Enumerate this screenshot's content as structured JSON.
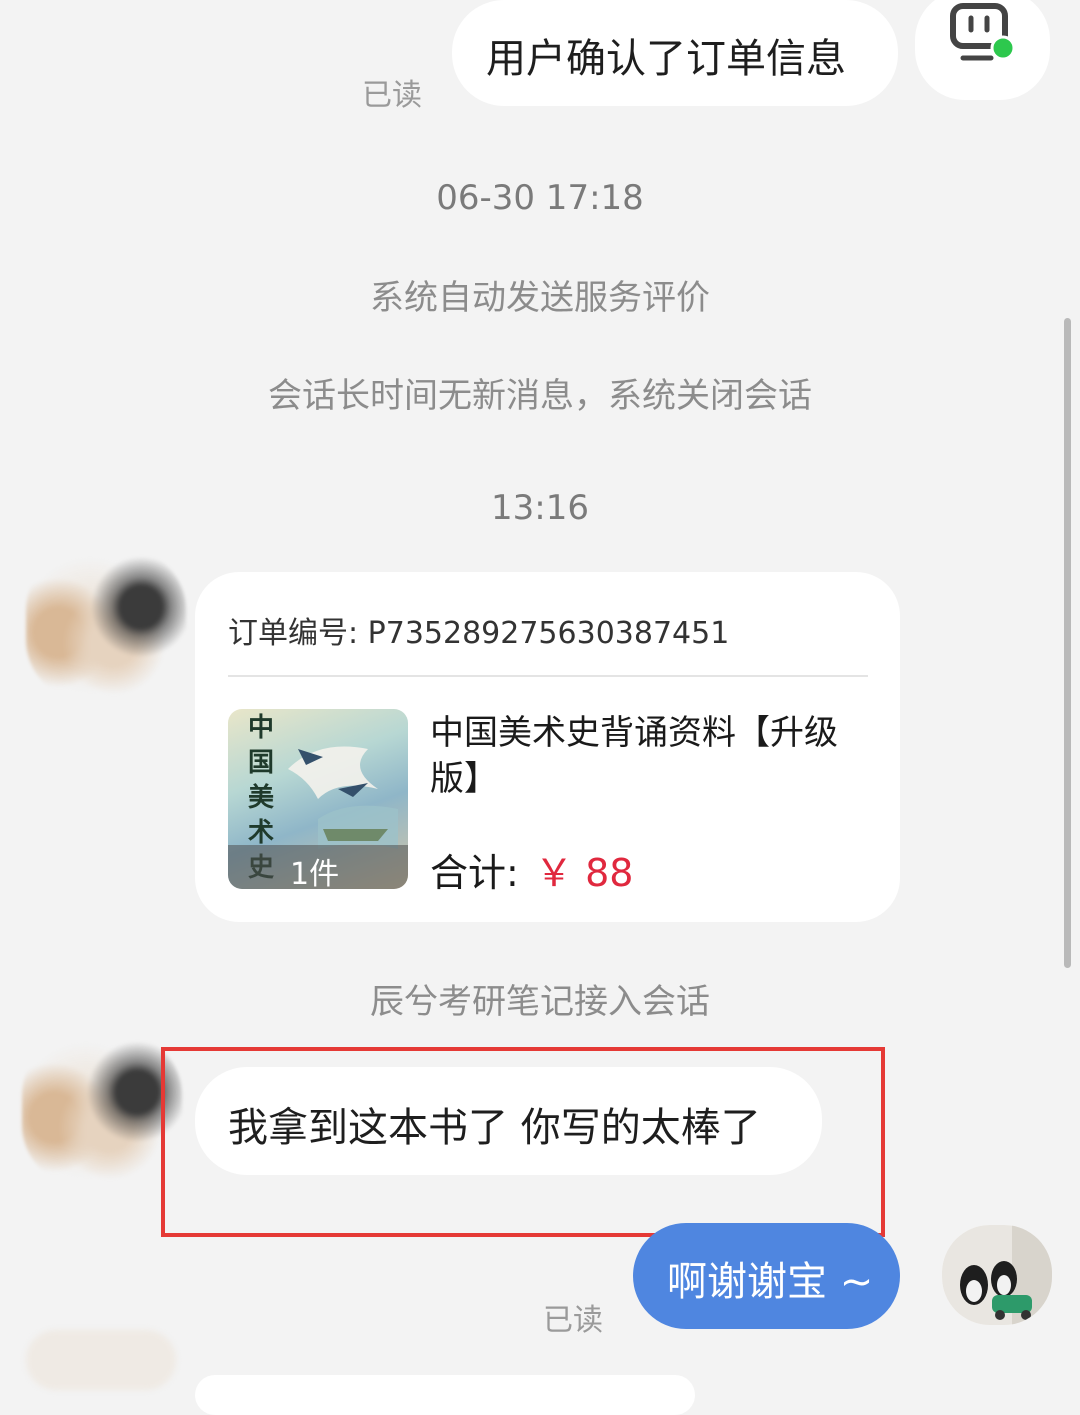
{
  "messages": {
    "top_outgoing": {
      "text": "用户确认了订单信息",
      "read": "已读"
    },
    "timestamp_1": "06-30 17:18",
    "system_1": "系统自动发送服务评价",
    "system_2": "会话长时间无新消息，系统关闭会话",
    "timestamp_2": "13:16",
    "system_3": "辰兮考研笔记接入会话",
    "incoming_highlighted": {
      "text": "我拿到这本书了 你写的太棒了"
    },
    "bottom_outgoing": {
      "text": "啊谢谢宝 ~",
      "read": "已读"
    }
  },
  "order_card": {
    "order_number_label": "订单编号: P735289275630387451",
    "product": {
      "title": "中国美术史背诵资料【升级版】",
      "thumbnail_title": "中国美术史",
      "quantity": "1件"
    },
    "total_label": "合计:",
    "total_value": "￥ 88"
  },
  "colors": {
    "accent_blue": "#4f86e0",
    "price_red": "#e0283e",
    "highlight_red": "#e53935",
    "background": "#f3f3f3"
  },
  "icons": {
    "robot": "robot-icon",
    "online_dot": "online-status-dot"
  }
}
